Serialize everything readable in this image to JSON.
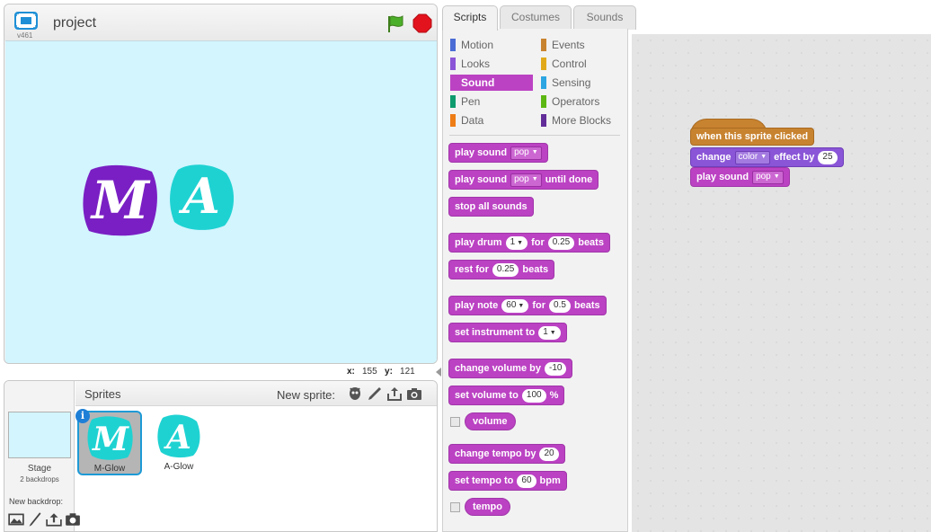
{
  "stage": {
    "project_title": "project",
    "version": "v461",
    "coords": {
      "x_label": "x:",
      "x_value": "155",
      "y_label": "y:",
      "y_value": "121"
    },
    "sprites_on_stage": [
      {
        "letter": "M",
        "color": "#7a1fc4"
      },
      {
        "letter": "A",
        "color": "#1fd2d2"
      }
    ]
  },
  "sprite_library": {
    "sprites_label": "Sprites",
    "new_sprite_label": "New sprite:",
    "stage_label": "Stage",
    "stage_sub": "2 backdrops",
    "new_backdrop_label": "New backdrop:",
    "info_glyph": "i",
    "tiles": [
      {
        "name": "M-Glow",
        "letter": "M",
        "selected": true
      },
      {
        "name": "A-Glow",
        "letter": "A",
        "selected": false
      }
    ]
  },
  "tabs": {
    "scripts": "Scripts",
    "costumes": "Costumes",
    "sounds": "Sounds"
  },
  "categories": {
    "motion": "Motion",
    "looks": "Looks",
    "sound": "Sound",
    "pen": "Pen",
    "data": "Data",
    "events": "Events",
    "control": "Control",
    "sensing": "Sensing",
    "operators": "Operators",
    "more": "More Blocks"
  },
  "colors": {
    "motion": "#4a6cd4",
    "looks": "#8a55d7",
    "sound": "#bb42c3",
    "pen": "#0e9a6c",
    "data": "#ee7d16",
    "events": "#c88330",
    "control": "#e1a91a",
    "sensing": "#2ca5e2",
    "operators": "#5cb712",
    "more": "#632d99"
  },
  "palette_blocks": {
    "play_sound": {
      "a": "play sound",
      "dd": "pop"
    },
    "play_sound_until": {
      "a": "play sound",
      "dd": "pop",
      "b": "until done"
    },
    "stop_all": "stop all sounds",
    "play_drum": {
      "a": "play drum",
      "dd": "1",
      "b": "for",
      "n": "0.25",
      "c": "beats"
    },
    "rest": {
      "a": "rest for",
      "n": "0.25",
      "b": "beats"
    },
    "play_note": {
      "a": "play note",
      "dd": "60",
      "b": "for",
      "n": "0.5",
      "c": "beats"
    },
    "set_instrument": {
      "a": "set instrument to",
      "dd": "1"
    },
    "change_volume": {
      "a": "change volume by",
      "n": "-10"
    },
    "set_volume": {
      "a": "set volume to",
      "n": "100",
      "b": "%"
    },
    "volume": "volume",
    "change_tempo": {
      "a": "change tempo by",
      "n": "20"
    },
    "set_tempo": {
      "a": "set tempo to",
      "n": "60",
      "b": "bpm"
    },
    "tempo": "tempo"
  },
  "script": {
    "hat": "when this sprite clicked",
    "change_effect": {
      "a": "change",
      "dd": "color",
      "b": "effect by",
      "n": "25"
    },
    "play_sound": {
      "a": "play sound",
      "dd": "pop"
    }
  }
}
